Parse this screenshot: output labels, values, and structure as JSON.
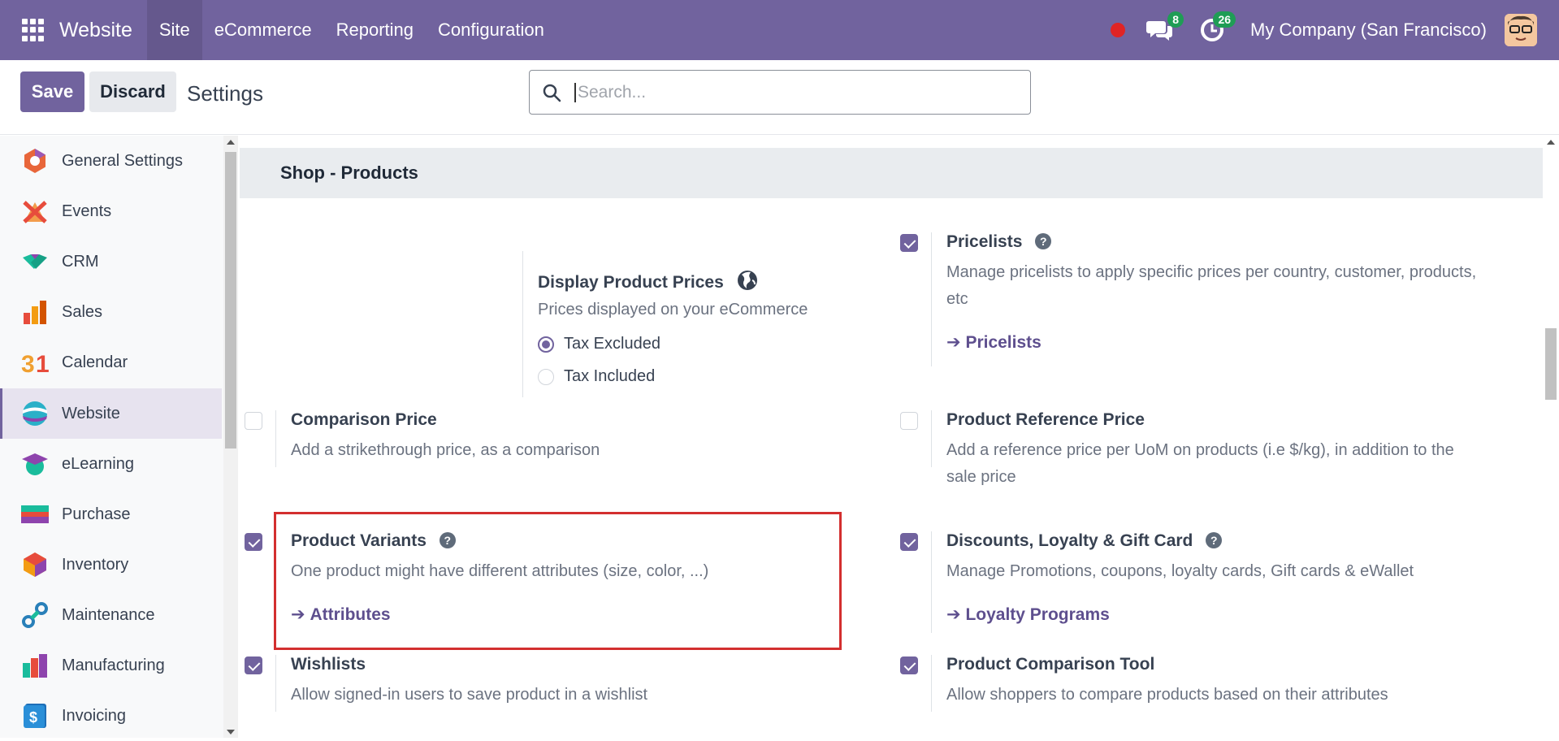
{
  "navbar": {
    "app_name": "Website",
    "menu": [
      "Site",
      "eCommerce",
      "Reporting",
      "Configuration"
    ],
    "messages_badge": "8",
    "activities_badge": "26",
    "company": "My Company (San Francisco)"
  },
  "control": {
    "save_label": "Save",
    "discard_label": "Discard",
    "breadcrumb": "Settings",
    "search_placeholder": "Search..."
  },
  "sidebar": {
    "items": [
      {
        "label": "General Settings",
        "icon": "general-settings-icon"
      },
      {
        "label": "Events",
        "icon": "events-icon"
      },
      {
        "label": "CRM",
        "icon": "crm-icon"
      },
      {
        "label": "Sales",
        "icon": "sales-icon"
      },
      {
        "label": "Calendar",
        "icon": "calendar-icon"
      },
      {
        "label": "Website",
        "icon": "website-icon",
        "active": true
      },
      {
        "label": "eLearning",
        "icon": "elearning-icon"
      },
      {
        "label": "Purchase",
        "icon": "purchase-icon"
      },
      {
        "label": "Inventory",
        "icon": "inventory-icon"
      },
      {
        "label": "Maintenance",
        "icon": "maintenance-icon"
      },
      {
        "label": "Manufacturing",
        "icon": "manufacturing-icon"
      },
      {
        "label": "Invoicing",
        "icon": "invoicing-icon"
      }
    ]
  },
  "section": {
    "title": "Shop - Products"
  },
  "settings": {
    "display_prices": {
      "title": "Display Product Prices",
      "desc": "Prices displayed on your eCommerce",
      "options": [
        "Tax Excluded",
        "Tax Included"
      ],
      "selected": "Tax Excluded"
    },
    "pricelists": {
      "title": "Pricelists",
      "desc": "Manage pricelists to apply specific prices per country, customer, products, etc",
      "link": "Pricelists",
      "checked": true
    },
    "comparison_price": {
      "title": "Comparison Price",
      "desc": "Add a strikethrough price, as a comparison",
      "checked": false
    },
    "reference_price": {
      "title": "Product Reference Price",
      "desc": "Add a reference price per UoM on products (i.e $/kg), in addition to the sale price",
      "checked": false
    },
    "variants": {
      "title": "Product Variants",
      "desc": "One product might have different attributes (size, color, ...)",
      "link": "Attributes",
      "checked": true
    },
    "discounts": {
      "title": "Discounts, Loyalty & Gift Card",
      "desc": "Manage Promotions, coupons, loyalty cards, Gift cards & eWallet",
      "link": "Loyalty Programs",
      "checked": true
    },
    "wishlists": {
      "title": "Wishlists",
      "desc": "Allow signed-in users to save product in a wishlist",
      "checked": true
    },
    "comparison_tool": {
      "title": "Product Comparison Tool",
      "desc": "Allow shoppers to compare products based on their attributes",
      "checked": true
    }
  },
  "colors": {
    "brand": "#71639e",
    "highlight": "#d32f2f",
    "badge": "#1f9d55",
    "record": "#e02424"
  }
}
